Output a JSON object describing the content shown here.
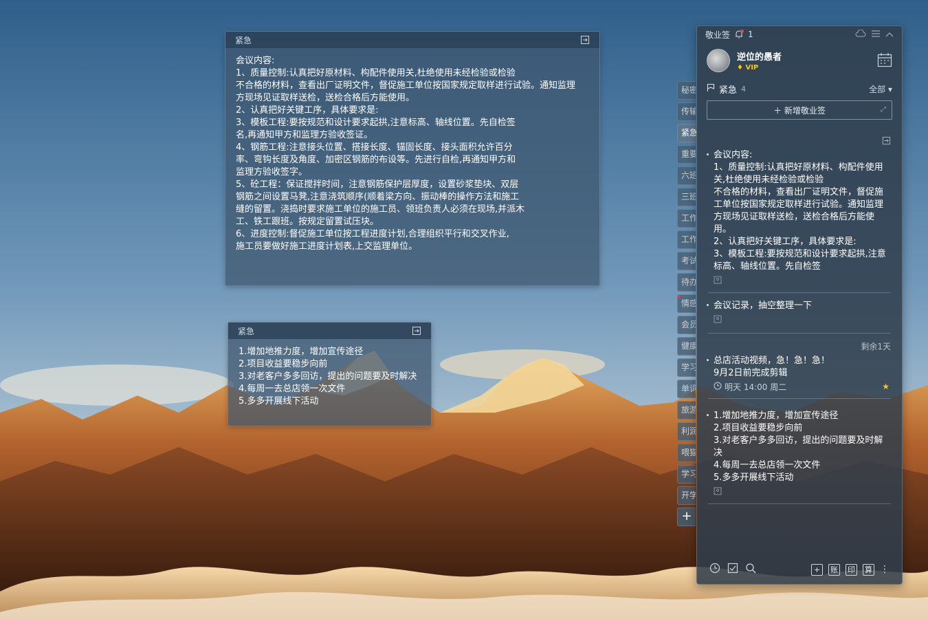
{
  "note1": {
    "category": "紧急",
    "lines": [
      "会议内容:",
      "1、质量控制:认真把好原材料、构配件使用关,杜绝使用未经检验或检验",
      "不合格的材料，查看出厂证明文件，督促施工单位按国家规定取样进行试验。通知监理",
      "方现场见证取样送检，送检合格后方能使用。",
      "2、认真把好关键工序，具体要求是:",
      "3、模板工程:要按规范和设计要求起拱,注意标高、轴线位置。先自检签",
      "名,再通知甲方和监理方验收签证。",
      "4、钢筋工程:注意接头位置、搭接长度、锚固长度、接头面积允许百分",
      "率、弯钩长度及角度、加密区钢筋的布设等。先进行自检,再通知甲方和",
      "监理方验收签字。",
      "5、砼工程：保证搅拌时间，注意钢筋保护层厚度，设置砂浆垫块、双层",
      "钢筋之间设置马凳,注意浇筑顺序(顺着梁方向、振动棒的操作方法和施工",
      "缝的留置。浇捣时要求施工单位的施工员、领班负责人必须在现场,并派木",
      "工、铁工跟班。按规定留置试压块。",
      "6、进度控制:督促施工单位按工程进度计划,合理组织平行和交叉作业,",
      "施工员要做好施工进度计划表,上交监理单位。"
    ]
  },
  "note2": {
    "category": "紧急",
    "lines": [
      "1.增加地推力度，增加宣传途径",
      "2.项目收益要稳步向前",
      "3.对老客户多多回访，提出的问题要及时解决",
      "4.每周一去总店领一次文件",
      "5.多多开展线下活动"
    ]
  },
  "tabs": [
    "秘密",
    "传输",
    "紧急",
    "重要",
    "六班",
    "三班",
    "工作",
    "工作",
    "考试",
    "待办",
    "情感",
    "会员",
    "健康",
    "学习",
    "单词",
    "旅游",
    "利润",
    "喂猫",
    "学习",
    "开学"
  ],
  "panel": {
    "app_name": "敬业签",
    "notif_count": "1",
    "user_name": "逆位的愚者",
    "vip_label": "VIP",
    "category": "紧急",
    "category_count": "4",
    "filter": "全部 ▾",
    "add_label": "＋ 新增敬业签",
    "items": {
      "i1": [
        "会议内容:",
        "1、质量控制:认真把好原材料、构配件使用",
        "关,杜绝使用未经检验或检验",
        "不合格的材料，查看出厂证明文件，督促施",
        "工单位按国家规定取样进行试验。通知监理",
        "方现场见证取样送检，送检合格后方能使",
        "用。",
        "2、认真把好关键工序，具体要求是:",
        "3、模板工程:要按规范和设计要求起拱,注意",
        "标高、轴线位置。先自检签"
      ],
      "i2": "会议记录，抽空整理一下",
      "i3_remain": "剩余1天",
      "i3": [
        "总店活动视频，急！急！急！",
        "9月2日前完成剪辑"
      ],
      "i3_time": "明天 14:00 周二",
      "i4": [
        "1.增加地推力度，增加宣传途径",
        "2.项目收益要稳步向前",
        "3.对老客户多多回访，提出的问题要及时解",
        "决",
        "4.每周一去总店领一次文件",
        "5.多多开展线下活动"
      ]
    },
    "bottom_buttons": [
      "+",
      "账",
      "印",
      "算"
    ]
  }
}
